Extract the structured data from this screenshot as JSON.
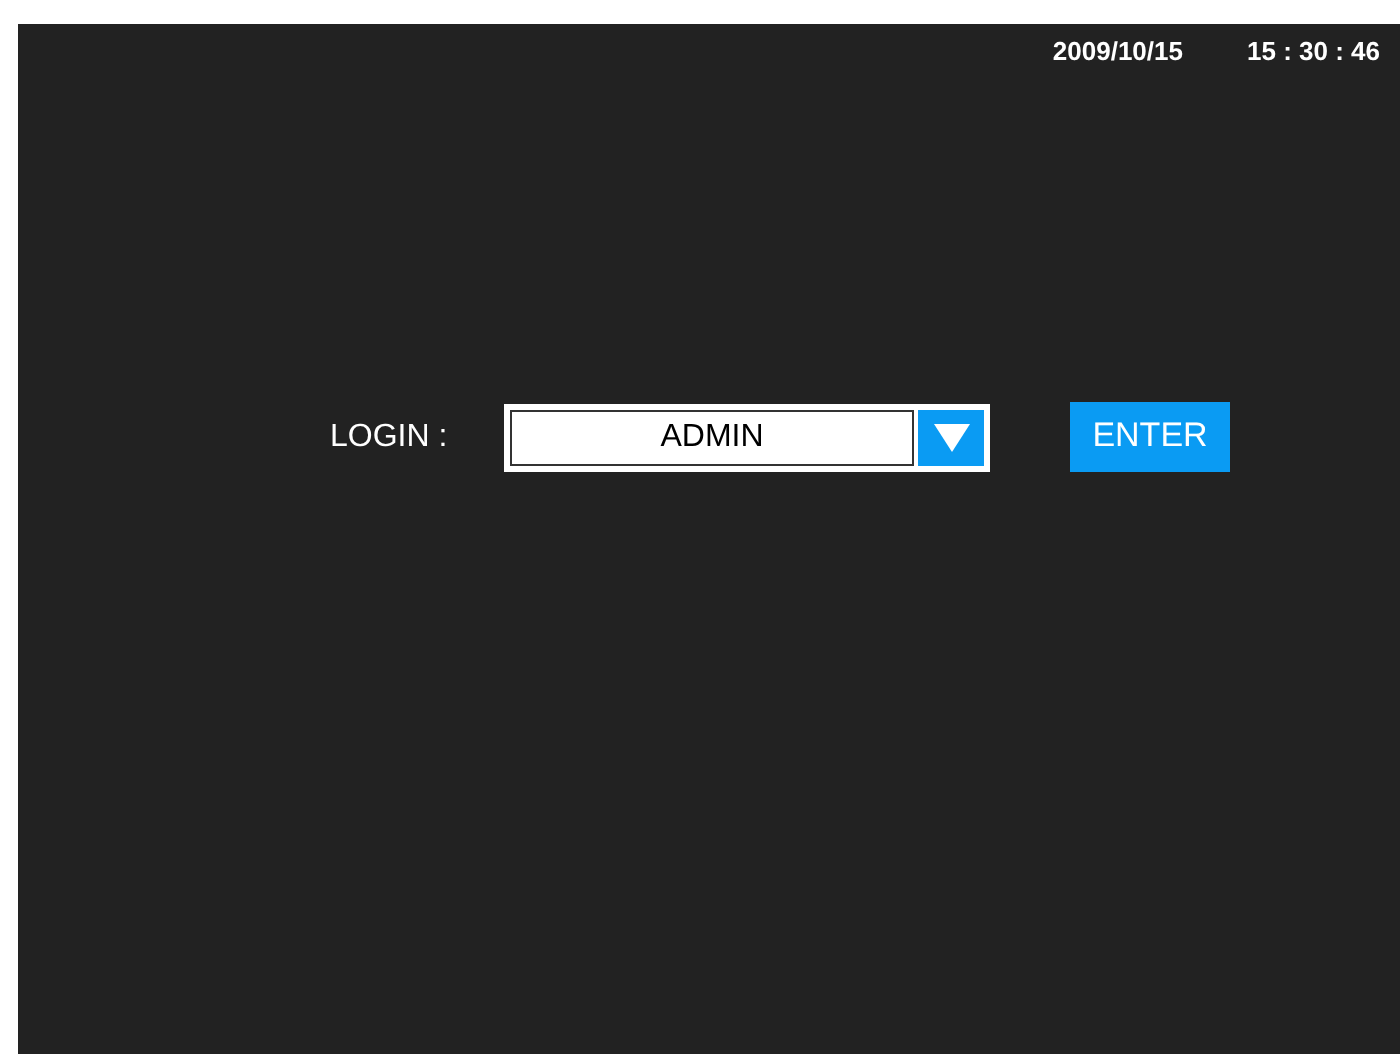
{
  "status_bar": {
    "date": "2009/10/15",
    "time": "15 : 30 : 46"
  },
  "login": {
    "label": "LOGIN :",
    "user_select": {
      "value": "ADMIN"
    },
    "enter_button": "ENTER"
  }
}
